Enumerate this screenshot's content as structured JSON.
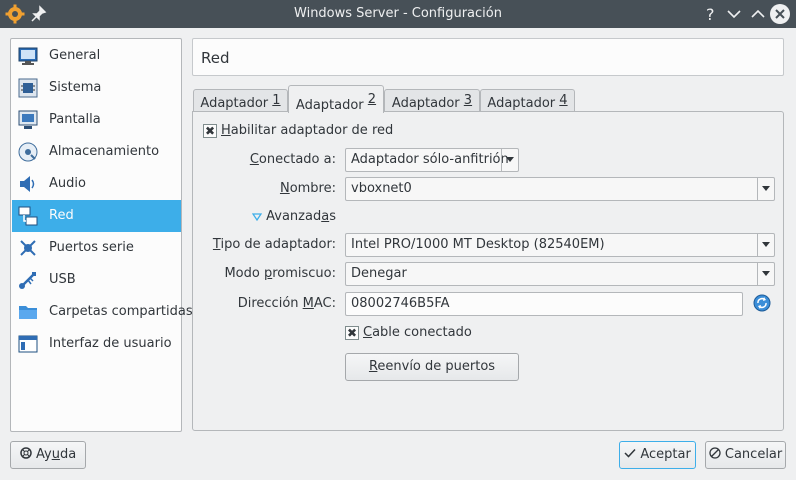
{
  "window": {
    "title": "Windows Server - Configuración",
    "buttons": {
      "help": "?",
      "minimize": "chevron-down",
      "maximize": "chevron-up",
      "close": "close"
    }
  },
  "sidebar": {
    "items": [
      {
        "label": "General",
        "icon": "monitor-icon",
        "selected": false
      },
      {
        "label": "Sistema",
        "icon": "chip-icon",
        "selected": false
      },
      {
        "label": "Pantalla",
        "icon": "display-icon",
        "selected": false
      },
      {
        "label": "Almacenamiento",
        "icon": "disk-icon",
        "selected": false
      },
      {
        "label": "Audio",
        "icon": "speaker-icon",
        "selected": false
      },
      {
        "label": "Red",
        "icon": "network-icon",
        "selected": true
      },
      {
        "label": "Puertos serie",
        "icon": "serial-port-icon",
        "selected": false
      },
      {
        "label": "USB",
        "icon": "usb-icon",
        "selected": false
      },
      {
        "label": "Carpetas compartidas",
        "icon": "folder-icon",
        "selected": false
      },
      {
        "label": "Interfaz de usuario",
        "icon": "ui-window-icon",
        "selected": false
      }
    ]
  },
  "header": {
    "title": "Red"
  },
  "tabs": [
    {
      "label_pre": "Adaptador ",
      "label_key": "1",
      "active": false
    },
    {
      "label_pre": "Adaptador ",
      "label_key": "2",
      "active": true
    },
    {
      "label_pre": "Adaptador ",
      "label_key": "3",
      "active": false
    },
    {
      "label_pre": "Adaptador ",
      "label_key": "4",
      "active": false
    }
  ],
  "adapter": {
    "enable": {
      "key": "H",
      "rest": "abilitar adaptador de red",
      "checked": true
    },
    "attached": {
      "label_key": "C",
      "label_rest": "onectado a:",
      "value": "Adaptador sólo-anfitrión"
    },
    "name": {
      "label_key": "N",
      "label_rest": "ombre:",
      "value": "vboxnet0"
    },
    "advanced": {
      "pre": "Avanzad",
      "key": "a",
      "post": "s"
    },
    "type": {
      "label_key": "T",
      "label_rest": "ipo de adaptador:",
      "value": "Intel PRO/1000 MT Desktop (82540EM)"
    },
    "promisc": {
      "label_pre": "Modo ",
      "label_key": "p",
      "label_rest": "romiscuo:",
      "value": "Denegar"
    },
    "mac": {
      "label_pre": "Dirección ",
      "label_key": "M",
      "label_rest": "AC:",
      "value": "08002746B5FA"
    },
    "cable": {
      "key": "C",
      "rest": "able conectado",
      "checked": true
    },
    "port_forward": {
      "key": "R",
      "rest": "eenvío de puertos"
    }
  },
  "footer": {
    "help": {
      "pre": "Ay",
      "key": "u",
      "post": "da"
    },
    "accept": "Aceptar",
    "cancel": "Cancelar"
  },
  "colors": {
    "titlebar": "#475057",
    "selection": "#3daee9",
    "background": "#eff0f1"
  }
}
